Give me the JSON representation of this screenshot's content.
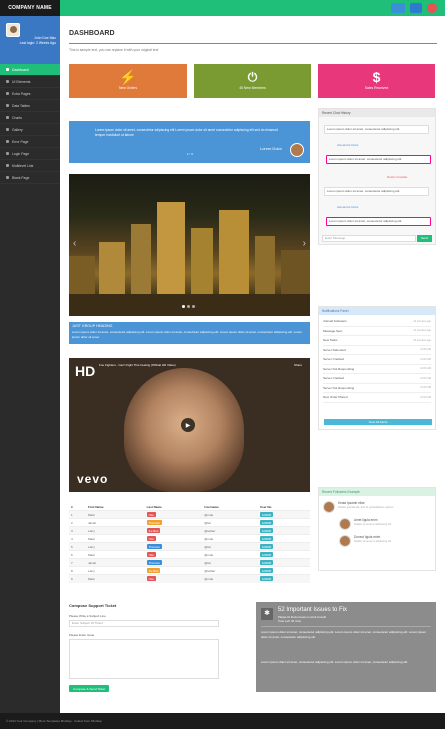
{
  "topbar": {
    "brand": "COMPANY NAME",
    "accent": "#1fbf7a",
    "icons": [
      "mail-icon",
      "list-icon",
      "bell-icon"
    ]
  },
  "sidebar": {
    "profile": {
      "name": "John Doe Mac",
      "status": "Last login: 2 Weeks Ago"
    },
    "items": [
      {
        "label": "Dashboard",
        "active": true
      },
      {
        "label": "UI Elements"
      },
      {
        "label": "Extra Pages"
      },
      {
        "label": "Data Tables"
      },
      {
        "label": "Charts"
      },
      {
        "label": "Gallery"
      },
      {
        "label": "Error Page"
      },
      {
        "label": "Login Page"
      },
      {
        "label": "Multilevel Link"
      },
      {
        "label": "Blank Page"
      }
    ]
  },
  "main": {
    "title": "DASHBOARD",
    "subtitle": "This is sample text, you can replace it with your original text",
    "stats": [
      {
        "label": "New Orders",
        "icon": "bolt-icon",
        "color": "#e07a3a"
      },
      {
        "label": "45 New Members",
        "icon": "plug-icon",
        "color": "#7a9a32"
      },
      {
        "label": "Sales Received",
        "icon": "dollar-icon",
        "color": "#e8377a"
      }
    ],
    "quote": {
      "text": "Lorem ipsum dolor sit amet, consectetur adipiscing elit Lorem ipsum dolor sit amet consectetur adipiscing elit sed do eiusmod tempor incididunt ut labore",
      "author": "Lorem Dolor",
      "page": "1 / 3"
    },
    "info": {
      "heading": "JUST GROUP HEADING",
      "text": "Lorem ipsum dolor sit amet, consectetur adipiscing elit. Lorem ipsum dolor sit amet, consectetur adipiscing elit. Lorem ipsum dolor sit amet, consectetur adipiscing elit. Lorem ipsum dolor sit amet."
    },
    "video": {
      "badge": "HD",
      "title": "Foo Fighters - Can't Fight This Feeling (Official HD Video)",
      "share": "Share",
      "brand": "vevo"
    },
    "table": {
      "headers": [
        "#",
        "First Name",
        "Last Name",
        "Username",
        "User No."
      ],
      "rows": [
        [
          "1",
          "Mark",
          "Otto",
          "@mdo",
          "100090",
          "#e05555"
        ],
        [
          "2",
          "Jacob",
          "Thornton",
          "@fat",
          "100090",
          "#f0a030"
        ],
        [
          "3",
          "Larry",
          "the Bird",
          "@twitter",
          "100090",
          "#e05555"
        ],
        [
          "4",
          "Mark",
          "Otto",
          "@mdo",
          "100090",
          "#e05555"
        ],
        [
          "5",
          "Larry",
          "Thornton",
          "@fat",
          "100090",
          "#3b8fd8"
        ],
        [
          "6",
          "Mark",
          "Otto",
          "@mdo",
          "100090",
          "#e05555"
        ],
        [
          "7",
          "Jacob",
          "Thornton",
          "@fat",
          "100090",
          "#3b8fd8"
        ],
        [
          "8",
          "Larry",
          "the Bird",
          "@twitter",
          "100090",
          "#f0a030"
        ],
        [
          "9",
          "Mark",
          "Otto",
          "@mdo",
          "100090",
          "#e05555"
        ]
      ]
    },
    "support": {
      "heading": "Compose Support Ticket",
      "subject_label": "Please Write a Subject Line",
      "subject_placeholder": "Enter Subject Of Ticket",
      "detail_label": "Please Enter Issue",
      "button": "Compose & Send Ticket"
    },
    "issues": {
      "title": "52 Important Issues to Fix",
      "subtitle": "Please fix these issues to work smooth",
      "time": "Time Left: 30 mins",
      "text1": "Lorem ipsum dolor sit amet, consectetur adipiscing elit. Lorem ipsum dolor sit amet, consectetur adipiscing elit. Lorem ipsum dolor sit amet, consectetur adipiscing elit.",
      "text2": "Lorem ipsum dolor sit amet, consectetur adipiscing elit. Lorem ipsum dolor sit amet, consectetur adipiscing elit."
    }
  },
  "chat": {
    "title": "Recent Chat History",
    "messages": [
      {
        "text": "Lorem ipsum dolor sit amet, consectetur adipiscing elit.",
        "name": "Alexandre Dolor"
      },
      {
        "text": "Lorem ipsum dolor sit amet, consectetur adipiscing elit.",
        "name": "Dustin Crowdie"
      },
      {
        "text": "Lorem ipsum dolor sit amet, consectetur adipiscing elit.",
        "name": "Alexandre Dolor"
      },
      {
        "text": "Lorem ipsum dolor sit amet, consectetur adipiscing elit.",
        "name": ""
      }
    ],
    "placeholder": "Enter Message",
    "send": "Send"
  },
  "notifications": {
    "title": "Notifications Panel",
    "items": [
      {
        "label": "4 Email Followers",
        "time": "12 minutes ago"
      },
      {
        "label": "Message Sent",
        "time": "12 minutes ago"
      },
      {
        "label": "New Tasks",
        "time": "12 minutes ago"
      },
      {
        "label": "Server Rebooted",
        "time": "11:00 AM"
      },
      {
        "label": "Server Crashed",
        "time": "11:00 AM"
      },
      {
        "label": "Server Not Responding",
        "time": "11:00 AM"
      },
      {
        "label": "Server Crashed",
        "time": "11:00 AM"
      },
      {
        "label": "Server Not Responding",
        "time": "11:00 AM"
      },
      {
        "label": "New Order Placed",
        "time": "11:00 AM"
      }
    ],
    "view_all": "View All Alerts"
  },
  "friends": {
    "title": "Recent Followers Example",
    "items": [
      {
        "name": "Keala ipsamb elise",
        "note": "Nullam gravida elit, find sit posteaditious uelmus"
      },
      {
        "name": "Amet ligula enim",
        "note": "Nullam sit amet ut adipiscing elit."
      },
      {
        "name": "Donect ligula enim",
        "note": "Nullam sit amet ut adipiscing elit."
      }
    ]
  },
  "footer": {
    "text": "© 2014 Your Company | More Templates Mindtap - Collect from Mindtap"
  }
}
